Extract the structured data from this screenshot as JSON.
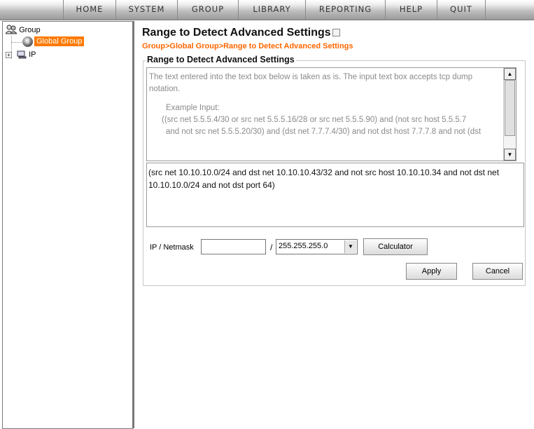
{
  "menu": {
    "items": [
      "HOME",
      "SYSTEM",
      "GROUP",
      "LIBRARY",
      "REPORTING",
      "HELP",
      "QUIT"
    ]
  },
  "tree": {
    "root_label": "Group",
    "selected_label": "Global Group",
    "ip_label": "IP"
  },
  "main": {
    "title": "Range to Detect Advanced Settings",
    "breadcrumb": "Group>Global Group>Range to Detect Advanced Settings",
    "section_title": "Range to Detect Advanced Settings",
    "info": {
      "line1": "The text entered into the text box below is taken as is. The input text box accepts tcp dump notation.",
      "line2": "Example Input:",
      "line3": "((src net 5.5.5.4/30 or src net 5.5.5.16/28 or src net 5.5.5.90) and (not src host 5.5.5.7",
      "line4": "and not src net 5.5.5.20/30) and (dst net 7.7.7.4/30) and not dst host 7.7.7.8 and not (dst"
    },
    "filter_value": "(src net 10.10.10.0/24 and dst net 10.10.10.43/32 and not src host 10.10.10.34 and not dst net 10.10.10.0/24 and not dst port 64)",
    "ip_label": "IP / Netmask",
    "ip_value": "",
    "slash": "/",
    "netmask_value": "255.255.255.0",
    "calculator_label": "Calculator",
    "apply_label": "Apply",
    "cancel_label": "Cancel"
  },
  "colors": {
    "accent": "#ff6600",
    "selection": "#ff7a00"
  }
}
